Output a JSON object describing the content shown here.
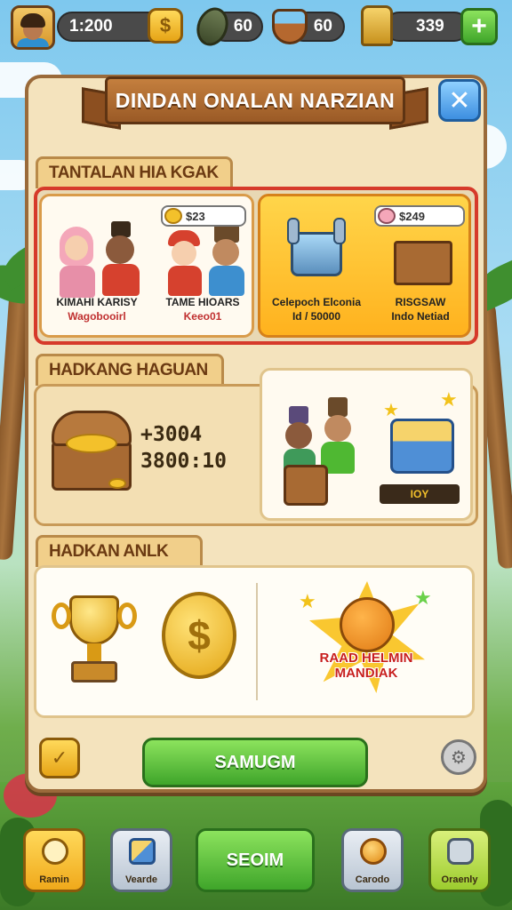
{
  "topbar": {
    "coins_value": "1:200",
    "coins_icon": "coin-plus-icon",
    "seeds_value": "60",
    "food_value": "60",
    "trophy_value": "339",
    "add_label": "+"
  },
  "dialog": {
    "title": "DINDAN ONALAN NARZIAN",
    "close_label": "✕"
  },
  "section1": {
    "header": "TANTALAN HIA KGAK",
    "cards": [
      {
        "name1": "KIMAHI KARISY",
        "name2": "Wagobooirl",
        "badge": "$23"
      },
      {
        "name1": "TAME HIOARS",
        "name2": "Keeo01",
        "badge": ""
      },
      {
        "name1": "Celepoch Elconia",
        "name2": "Id / 50000",
        "badge": ""
      },
      {
        "name1": "RISGSAW",
        "name2": "Indo Netiad",
        "badge": "$249"
      }
    ]
  },
  "section2": {
    "header": "HADKANG HAGUAN",
    "value1": "+3004",
    "value2": "3800:10",
    "button_label": "IOY"
  },
  "section3": {
    "header": "HADKAN ANLK",
    "burst_line1": "RAAD HELMIN",
    "burst_line2": "MANDIAK"
  },
  "main_button": "SAMUGM",
  "nav": {
    "items": [
      {
        "label": "Ramin"
      },
      {
        "label": "Vearde"
      },
      {
        "label": "SEOIM"
      },
      {
        "label": "Carodo"
      },
      {
        "label": "Oraenly"
      }
    ]
  },
  "colors": {
    "panel": "#f4e3bd",
    "banner": "#b06f33",
    "green": "#4fb832",
    "red_frame": "#d63a2a",
    "close_blue": "#3d8fe0"
  }
}
